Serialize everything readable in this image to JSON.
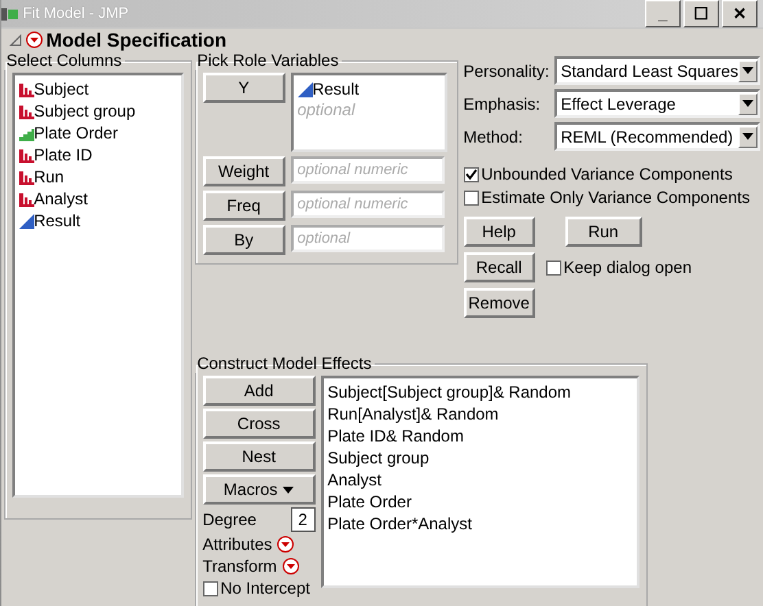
{
  "window": {
    "title": "Fit Model - JMP",
    "controls": [
      "_",
      "☐",
      "✕"
    ]
  },
  "header": {
    "title": "Model Specification",
    "expanded": true
  },
  "select_columns": {
    "title": "Select Columns",
    "items": [
      {
        "label": "Subject",
        "kind": "nominal"
      },
      {
        "label": "Subject group",
        "kind": "nominal"
      },
      {
        "label": "Plate Order",
        "kind": "ordinal"
      },
      {
        "label": "Plate ID",
        "kind": "nominal"
      },
      {
        "label": "Run",
        "kind": "nominal"
      },
      {
        "label": "Analyst",
        "kind": "nominal"
      },
      {
        "label": "Result",
        "kind": "continuous"
      }
    ]
  },
  "pick_roles": {
    "title": "Pick Role Variables",
    "roles": [
      {
        "button": "Y",
        "kind": "list",
        "items": [
          {
            "label": "Result",
            "kind": "continuous"
          }
        ],
        "placeholder": "optional"
      },
      {
        "button": "Weight",
        "kind": "field",
        "placeholder": "optional numeric"
      },
      {
        "button": "Freq",
        "kind": "field",
        "placeholder": "optional numeric"
      },
      {
        "button": "By",
        "kind": "field",
        "placeholder": "optional"
      }
    ]
  },
  "options": {
    "selects": [
      {
        "label": "Personality:",
        "value": "Standard Least Squares"
      },
      {
        "label": "Emphasis:",
        "value": "Effect Leverage"
      },
      {
        "label": "Method:",
        "value": "REML (Recommended)"
      }
    ],
    "checks": [
      {
        "label": "Unbounded Variance Components",
        "checked": true
      },
      {
        "label": "Estimate Only Variance Components",
        "checked": false
      }
    ],
    "buttons": [
      "Help",
      "Run",
      "Recall",
      "Remove"
    ],
    "keep_open": {
      "label": "Keep dialog open",
      "checked": false
    }
  },
  "effects": {
    "title": "Construct Model Effects",
    "buttons": [
      "Add",
      "Cross",
      "Nest"
    ],
    "macros": "Macros",
    "degree_label": "Degree",
    "degree": "2",
    "menus": [
      "Attributes",
      "Transform"
    ],
    "no_intercept": {
      "label": "No Intercept",
      "checked": false
    },
    "items": [
      "Subject[Subject group]& Random",
      "Run[Analyst]& Random",
      "Plate ID& Random",
      "Subject group",
      "Analyst",
      "Plate Order",
      "Plate Order*Analyst"
    ]
  }
}
